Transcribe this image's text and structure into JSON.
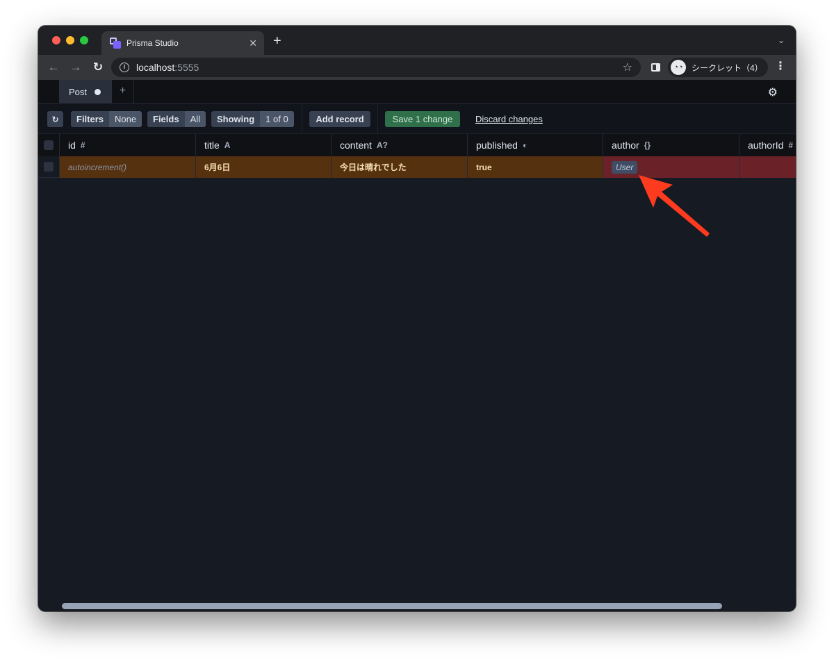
{
  "browser": {
    "tab_title": "Prisma Studio",
    "tab_close": "✕",
    "new_tab": "+",
    "tabs_menu": "⌄",
    "url_host": "localhost",
    "url_port": ":5555",
    "incognito_label": "シークレット（4）"
  },
  "studio": {
    "tab_label": "Post",
    "add_tab": "+",
    "toolbar": {
      "reload": "↻",
      "filters_label": "Filters",
      "filters_value": "None",
      "fields_label": "Fields",
      "fields_value": "All",
      "showing_label": "Showing",
      "showing_value": "1 of 0",
      "add_record": "Add record",
      "save": "Save 1 change",
      "discard": "Discard changes"
    },
    "columns": [
      {
        "name": "id",
        "type_icon": "#"
      },
      {
        "name": "title",
        "type_icon": "A"
      },
      {
        "name": "content",
        "type_icon": "A?"
      },
      {
        "name": "published",
        "type_icon": "◐"
      },
      {
        "name": "author",
        "type_icon": "{}"
      },
      {
        "name": "authorId",
        "type_icon": "#"
      }
    ],
    "rows": [
      {
        "id": "autoincrement()",
        "title": "6月6日",
        "content": "今日は晴れでした",
        "published": "true",
        "author": "User",
        "authorId": ""
      }
    ]
  },
  "colors": {
    "edited_cell": "#55310f",
    "invalid_cell": "#6a2228",
    "save_button": "#2f6f4a",
    "annotation_arrow": "#ff3b1f"
  }
}
